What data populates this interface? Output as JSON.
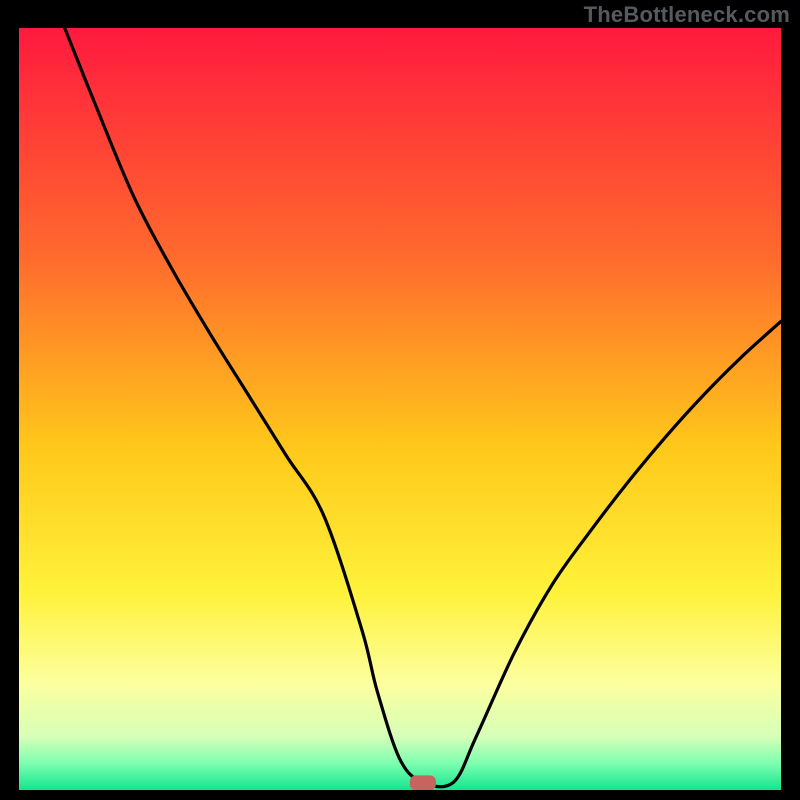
{
  "watermark": "TheBottleneck.com",
  "chart_data": {
    "type": "line",
    "title": "",
    "xlabel": "",
    "ylabel": "",
    "xlim": [
      0,
      100
    ],
    "ylim": [
      0,
      100
    ],
    "grid": false,
    "legend": false,
    "background_gradient": [
      {
        "pos": 0.0,
        "color": "#ff1a3e"
      },
      {
        "pos": 0.3,
        "color": "#ff6a2d"
      },
      {
        "pos": 0.55,
        "color": "#ffc81a"
      },
      {
        "pos": 0.74,
        "color": "#fff23a"
      },
      {
        "pos": 0.86,
        "color": "#fcff9e"
      },
      {
        "pos": 0.93,
        "color": "#d6ffb8"
      },
      {
        "pos": 0.965,
        "color": "#7dffb0"
      },
      {
        "pos": 1.0,
        "color": "#13e58e"
      }
    ],
    "marker": {
      "x": 53,
      "y": 1,
      "color": "#c7645e"
    },
    "series": [
      {
        "name": "curve",
        "x": [
          6,
          10,
          15,
          20,
          25,
          30,
          35,
          40,
          45,
          47,
          50,
          53,
          57,
          60,
          65,
          70,
          75,
          80,
          85,
          90,
          95,
          100
        ],
        "y": [
          100,
          90,
          78,
          68.5,
          60,
          52,
          44,
          36,
          21,
          13,
          4,
          1,
          1,
          7,
          18,
          27,
          34,
          40.5,
          46.5,
          52,
          57,
          61.5
        ]
      }
    ]
  }
}
